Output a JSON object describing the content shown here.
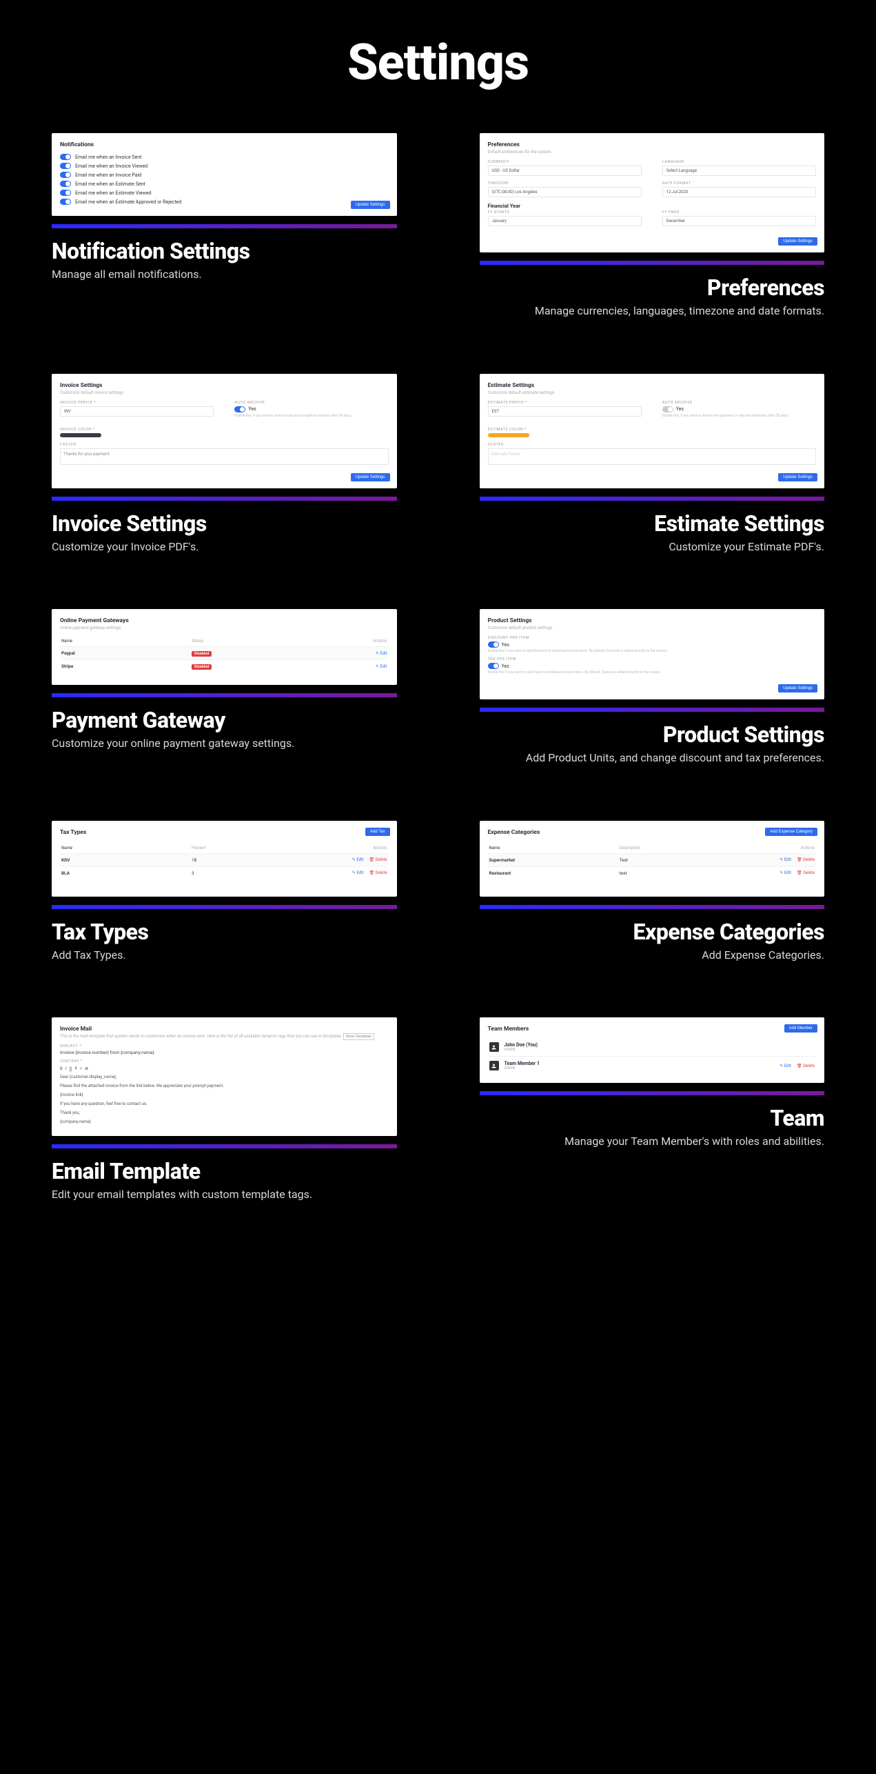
{
  "page": {
    "title": "Settings"
  },
  "common": {
    "updateBtn": "Update Settings",
    "edit": "Edit",
    "delete": "Delete",
    "yes": "Yes"
  },
  "cards": {
    "notifications": {
      "heading": "Notifications",
      "items": [
        "Email me when an Invoice Sent",
        "Email me when an Invoice Viewed",
        "Email me when an Invoice Paid",
        "Email me when an Estimate Sent",
        "Email me when an Estimate Viewed",
        "Email me when an Estimate Approved or Rejected"
      ],
      "title": "Notification Settings",
      "desc": "Manage all email notifications."
    },
    "preferences": {
      "heading": "Preferences",
      "sub": "Default preferences for the system.",
      "currencyLabel": "CURRENCY",
      "currency": "USD - US Dollar",
      "languageLabel": "LANGUAGE",
      "language": "Select Language",
      "timezoneLabel": "TIMEZONE",
      "timezone": "(UTC-08:00) Los Angeles",
      "dateFormatLabel": "DATE FORMAT",
      "dateFormat": "12.Jul.2020",
      "fyHeading": "Financial Year",
      "fyStartLabel": "FY STARTS",
      "fyStart": "January",
      "fyEndLabel": "FY ENDS",
      "fyEnd": "December",
      "title": "Preferences",
      "desc": "Manage currencies, languages, timezone and date formats."
    },
    "invoice": {
      "heading": "Invoice Settings",
      "sub": "Customize default invoice settings",
      "prefixLabel": "INVOICE PREFIX *",
      "prefix": "INV",
      "archiveLabel": "AUTO ARCHIVE",
      "archiveNote": "Enable this, if you want to archive paid and completed invoices after 30 days.",
      "colorLabel": "INVOICE COLOR *",
      "footerLabel": "FOOTER",
      "footer": "Thanks for your payment.",
      "title": "Invoice Settings",
      "desc": "Customize your Invoice PDF's."
    },
    "estimate": {
      "heading": "Estimate Settings",
      "sub": "Customize default estimate settings.",
      "prefixLabel": "ESTIMATE PREFIX *",
      "prefix": "EST",
      "archiveLabel": "AUTO ARCHIVE",
      "archiveNote": "Enable this, if you want to archive the approved or rejected estimates after 30 days.",
      "colorLabel": "ESTIMATE COLOR *",
      "footerLabel": "FOOTER",
      "footerPlaceholder": "Estimate Footer",
      "title": "Estimate Settings",
      "desc": "Customize your Estimate PDF's."
    },
    "gateway": {
      "heading": "Online Payment Gateways",
      "sub": "Online payment gateway settings.",
      "colName": "Name",
      "colStatus": "Status",
      "colActions": "Actions",
      "rows": [
        {
          "name": "Paypal",
          "status": "Disabled"
        },
        {
          "name": "Stripe",
          "status": "Disabled"
        }
      ],
      "title": "Payment Gateway",
      "desc": "Customize your online payment gateway settings."
    },
    "product": {
      "heading": "Product Settings",
      "sub": "Customize default product settings.",
      "discountLabel": "DISCOUNT PER ITEM",
      "discountNote": "Enable this if you want to add Discount to individual invoice items. By default, Discount is added directly to the invoice.",
      "taxLabel": "TAX PER ITEM",
      "taxNote": "Enable this if you want to add Taxes to individual invoice items. By default, Taxes are added directly to the invoice.",
      "title": "Product Settings",
      "desc": "Add Product Units, and change discount and tax preferences."
    },
    "tax": {
      "heading": "Tax Types",
      "addBtn": "Add Tax",
      "colName": "Name",
      "colPercent": "Percent",
      "colActions": "Actions",
      "rows": [
        {
          "name": "KDV",
          "percent": "18"
        },
        {
          "name": "BLA",
          "percent": "3"
        }
      ],
      "title": "Tax Types",
      "desc": "Add Tax Types."
    },
    "expense": {
      "heading": "Expense Categories",
      "addBtn": "Add Expense Category",
      "colName": "Name",
      "colDesc": "Description",
      "colActions": "Actions",
      "rows": [
        {
          "name": "Supermarket",
          "desc": "Test"
        },
        {
          "name": "Restaurant",
          "desc": "test"
        }
      ],
      "title": "Expense Categories",
      "desc": "Add Expense Categories."
    },
    "mail": {
      "heading": "Invoice Mail",
      "sub": "This is the mail template that system sends to customers when an invoice sent. Here is the list of all available dynamic tags that you can use in templates.",
      "showTemplates": "Show Templates",
      "subjectLabel": "SUBJECT *",
      "subject": "Invoice {invoice.number} from {company.name}",
      "contentLabel": "CONTENT *",
      "body": [
        "Dear {customer.display_name},",
        "Please find the attached invoice from the link below. We appreciate your prompt payment.",
        "{invoice.link}",
        "If you have any question, feel free to contact us.",
        "Thank you,",
        "{company.name}"
      ],
      "title": "Email Template",
      "desc": "Edit your email templates with custom template tags."
    },
    "team": {
      "heading": "Team Members",
      "addBtn": "Add Member",
      "members": [
        {
          "name": "John Doe (You)",
          "role": "ADMIN",
          "editable": false
        },
        {
          "name": "Team Member 1",
          "role": "ADMIN",
          "editable": true
        }
      ],
      "title": "Team",
      "desc": "Manage your Team Member's with roles and abilities."
    }
  }
}
